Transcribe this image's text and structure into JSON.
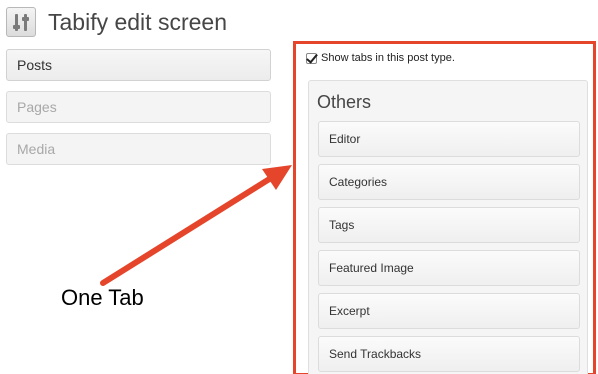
{
  "header": {
    "title": "Tabify edit screen",
    "icon": "settings-sliders-icon"
  },
  "post_types": [
    {
      "label": "Posts",
      "state": "active"
    },
    {
      "label": "Pages",
      "state": "inactive"
    },
    {
      "label": "Media",
      "state": "inactive"
    }
  ],
  "annotation": {
    "label": "One Tab",
    "color": "#e5452b"
  },
  "settings": {
    "show_tabs_label": "Show tabs in this post type.",
    "show_tabs_checked": true,
    "tab": {
      "title": "Others",
      "items": [
        {
          "label": "Editor"
        },
        {
          "label": "Categories"
        },
        {
          "label": "Tags"
        },
        {
          "label": "Featured Image"
        },
        {
          "label": "Excerpt"
        },
        {
          "label": "Send Trackbacks"
        }
      ]
    }
  }
}
